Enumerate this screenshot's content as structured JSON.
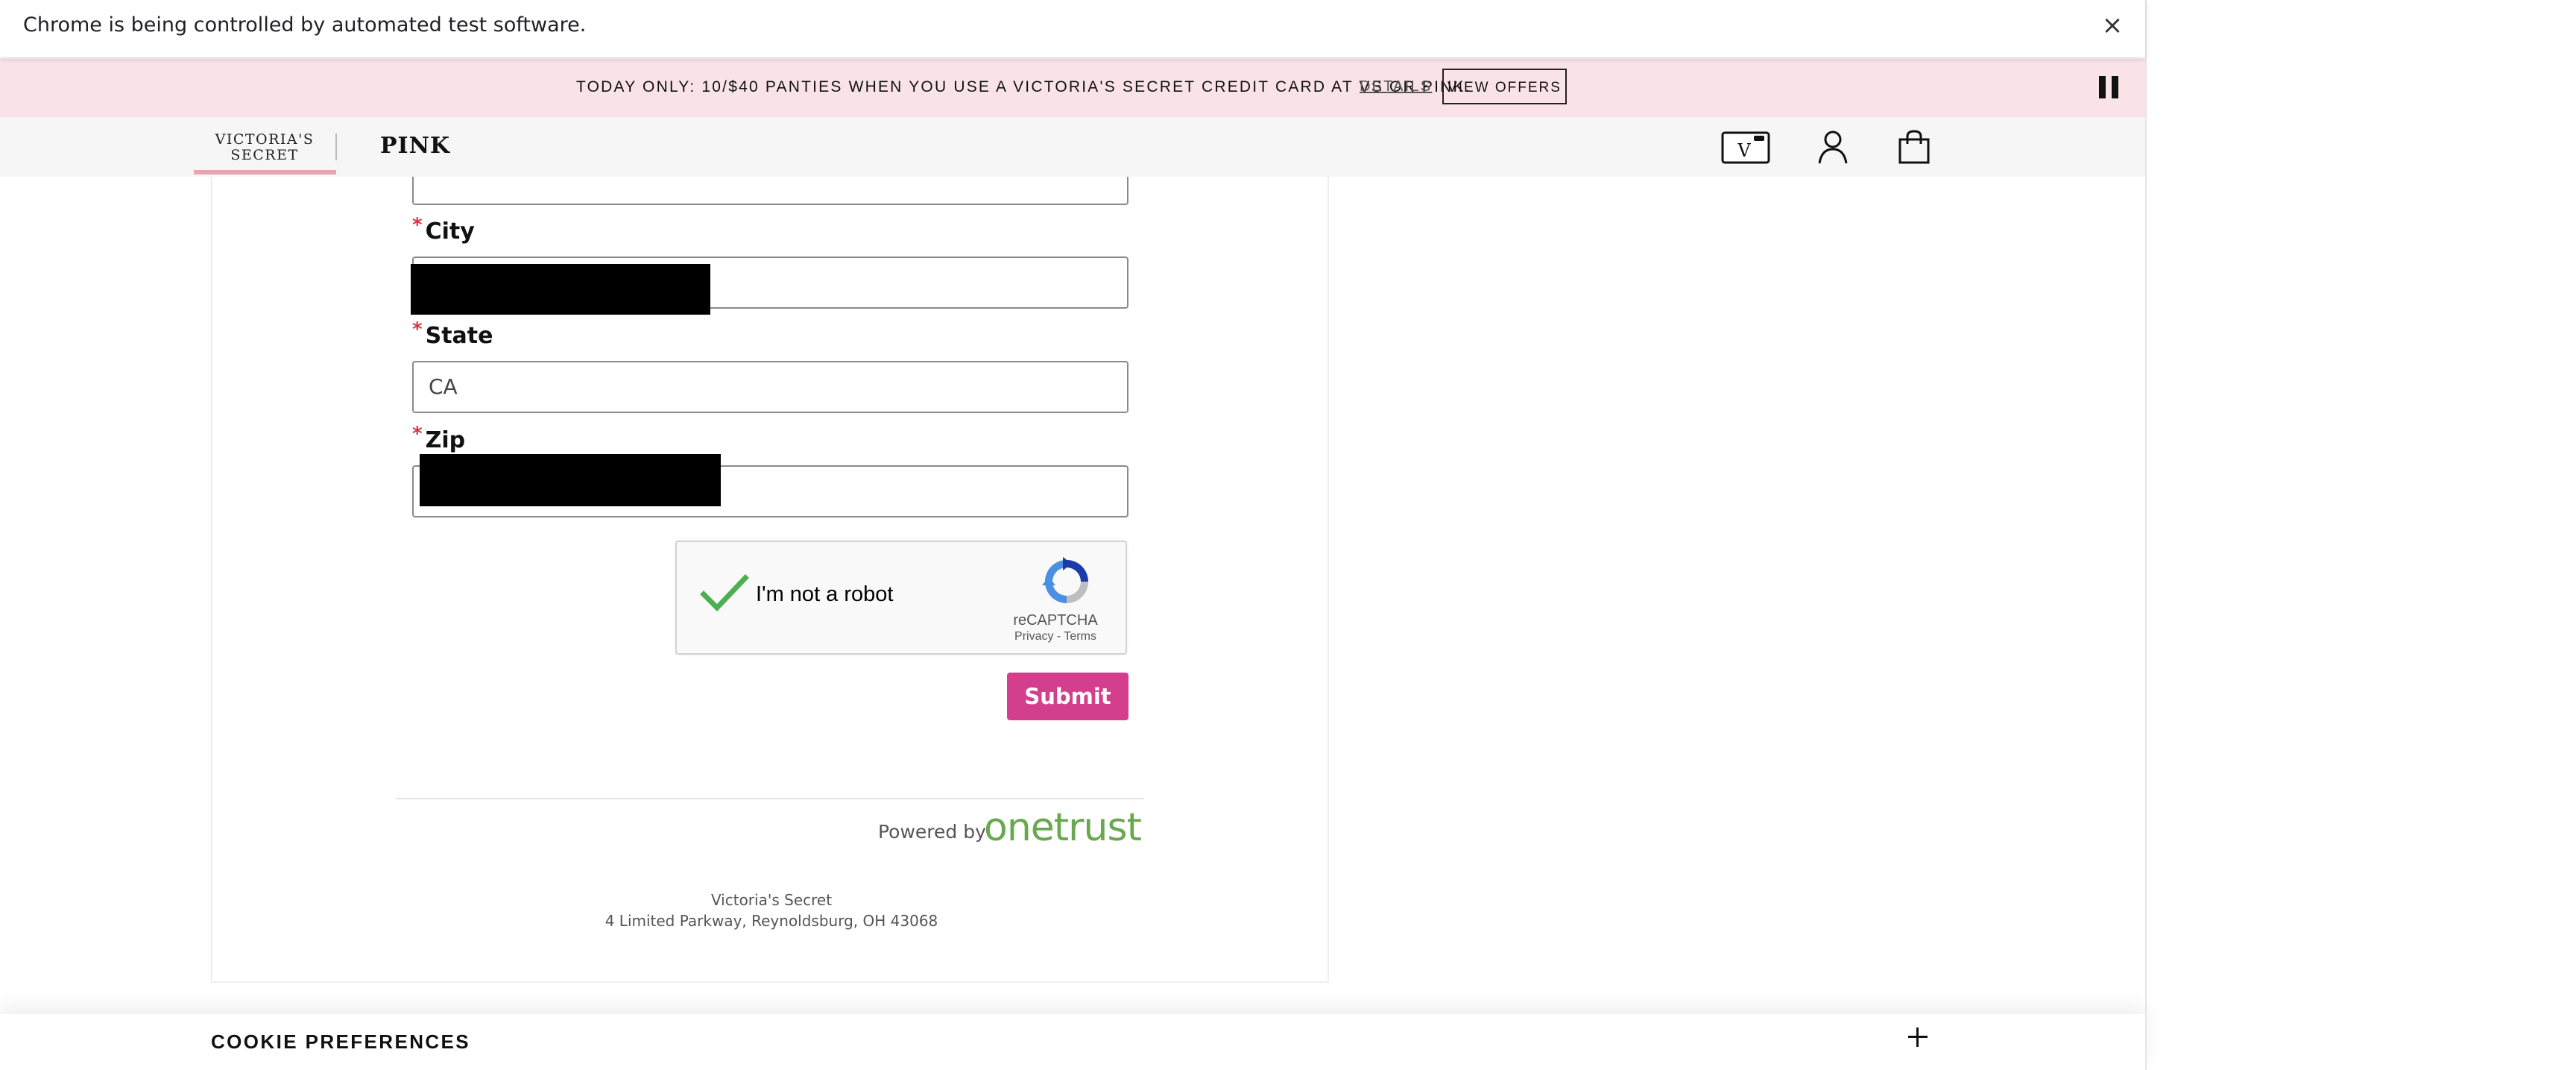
{
  "automation_bar": {
    "message": "Chrome is being controlled by automated test software.",
    "close_icon": "×"
  },
  "promo_bar": {
    "text": "TODAY ONLY: 10/$40 PANTIES WHEN YOU USE A VICTORIA'S SECRET CREDIT CARD AT VS OR PINK.",
    "details_label": "DETAILS",
    "view_offers_label": "VIEW OFFERS",
    "pause_icon": "pause-icon"
  },
  "nav": {
    "vs_logo_line1": "VICTORIA'S",
    "vs_logo_line2": "SECRET",
    "pink_logo": "PINK",
    "icons": [
      "credit-card-icon",
      "account-icon",
      "shopping-bag-icon"
    ]
  },
  "form": {
    "required_mark": "*",
    "fields": [
      {
        "label": "City",
        "value": ""
      },
      {
        "label": "State",
        "value": "CA"
      },
      {
        "label": "Zip",
        "value": ""
      }
    ],
    "submit_label": "Submit"
  },
  "recaptcha": {
    "checkbox_label": "I'm not a robot",
    "checked": true,
    "brand": "reCAPTCHA",
    "privacy_label": "Privacy",
    "separator": " - ",
    "terms_label": "Terms",
    "check_color": "#4caf50"
  },
  "footer": {
    "powered_by": "Powered by",
    "brand": "onetrust",
    "company": "Victoria's Secret",
    "address": "4 Limited Parkway, Reynoldsburg, OH 43068"
  },
  "cookie_preferences": {
    "title": "COOKIE PREFERENCES",
    "expand_icon": "plus-icon"
  },
  "colors": {
    "promo_background": "#f9e3e8",
    "nav_background": "#f6f6f6",
    "submit_background": "#d43f8d",
    "onetrust_green": "#6aa84f",
    "required_red": "#d9363e"
  }
}
